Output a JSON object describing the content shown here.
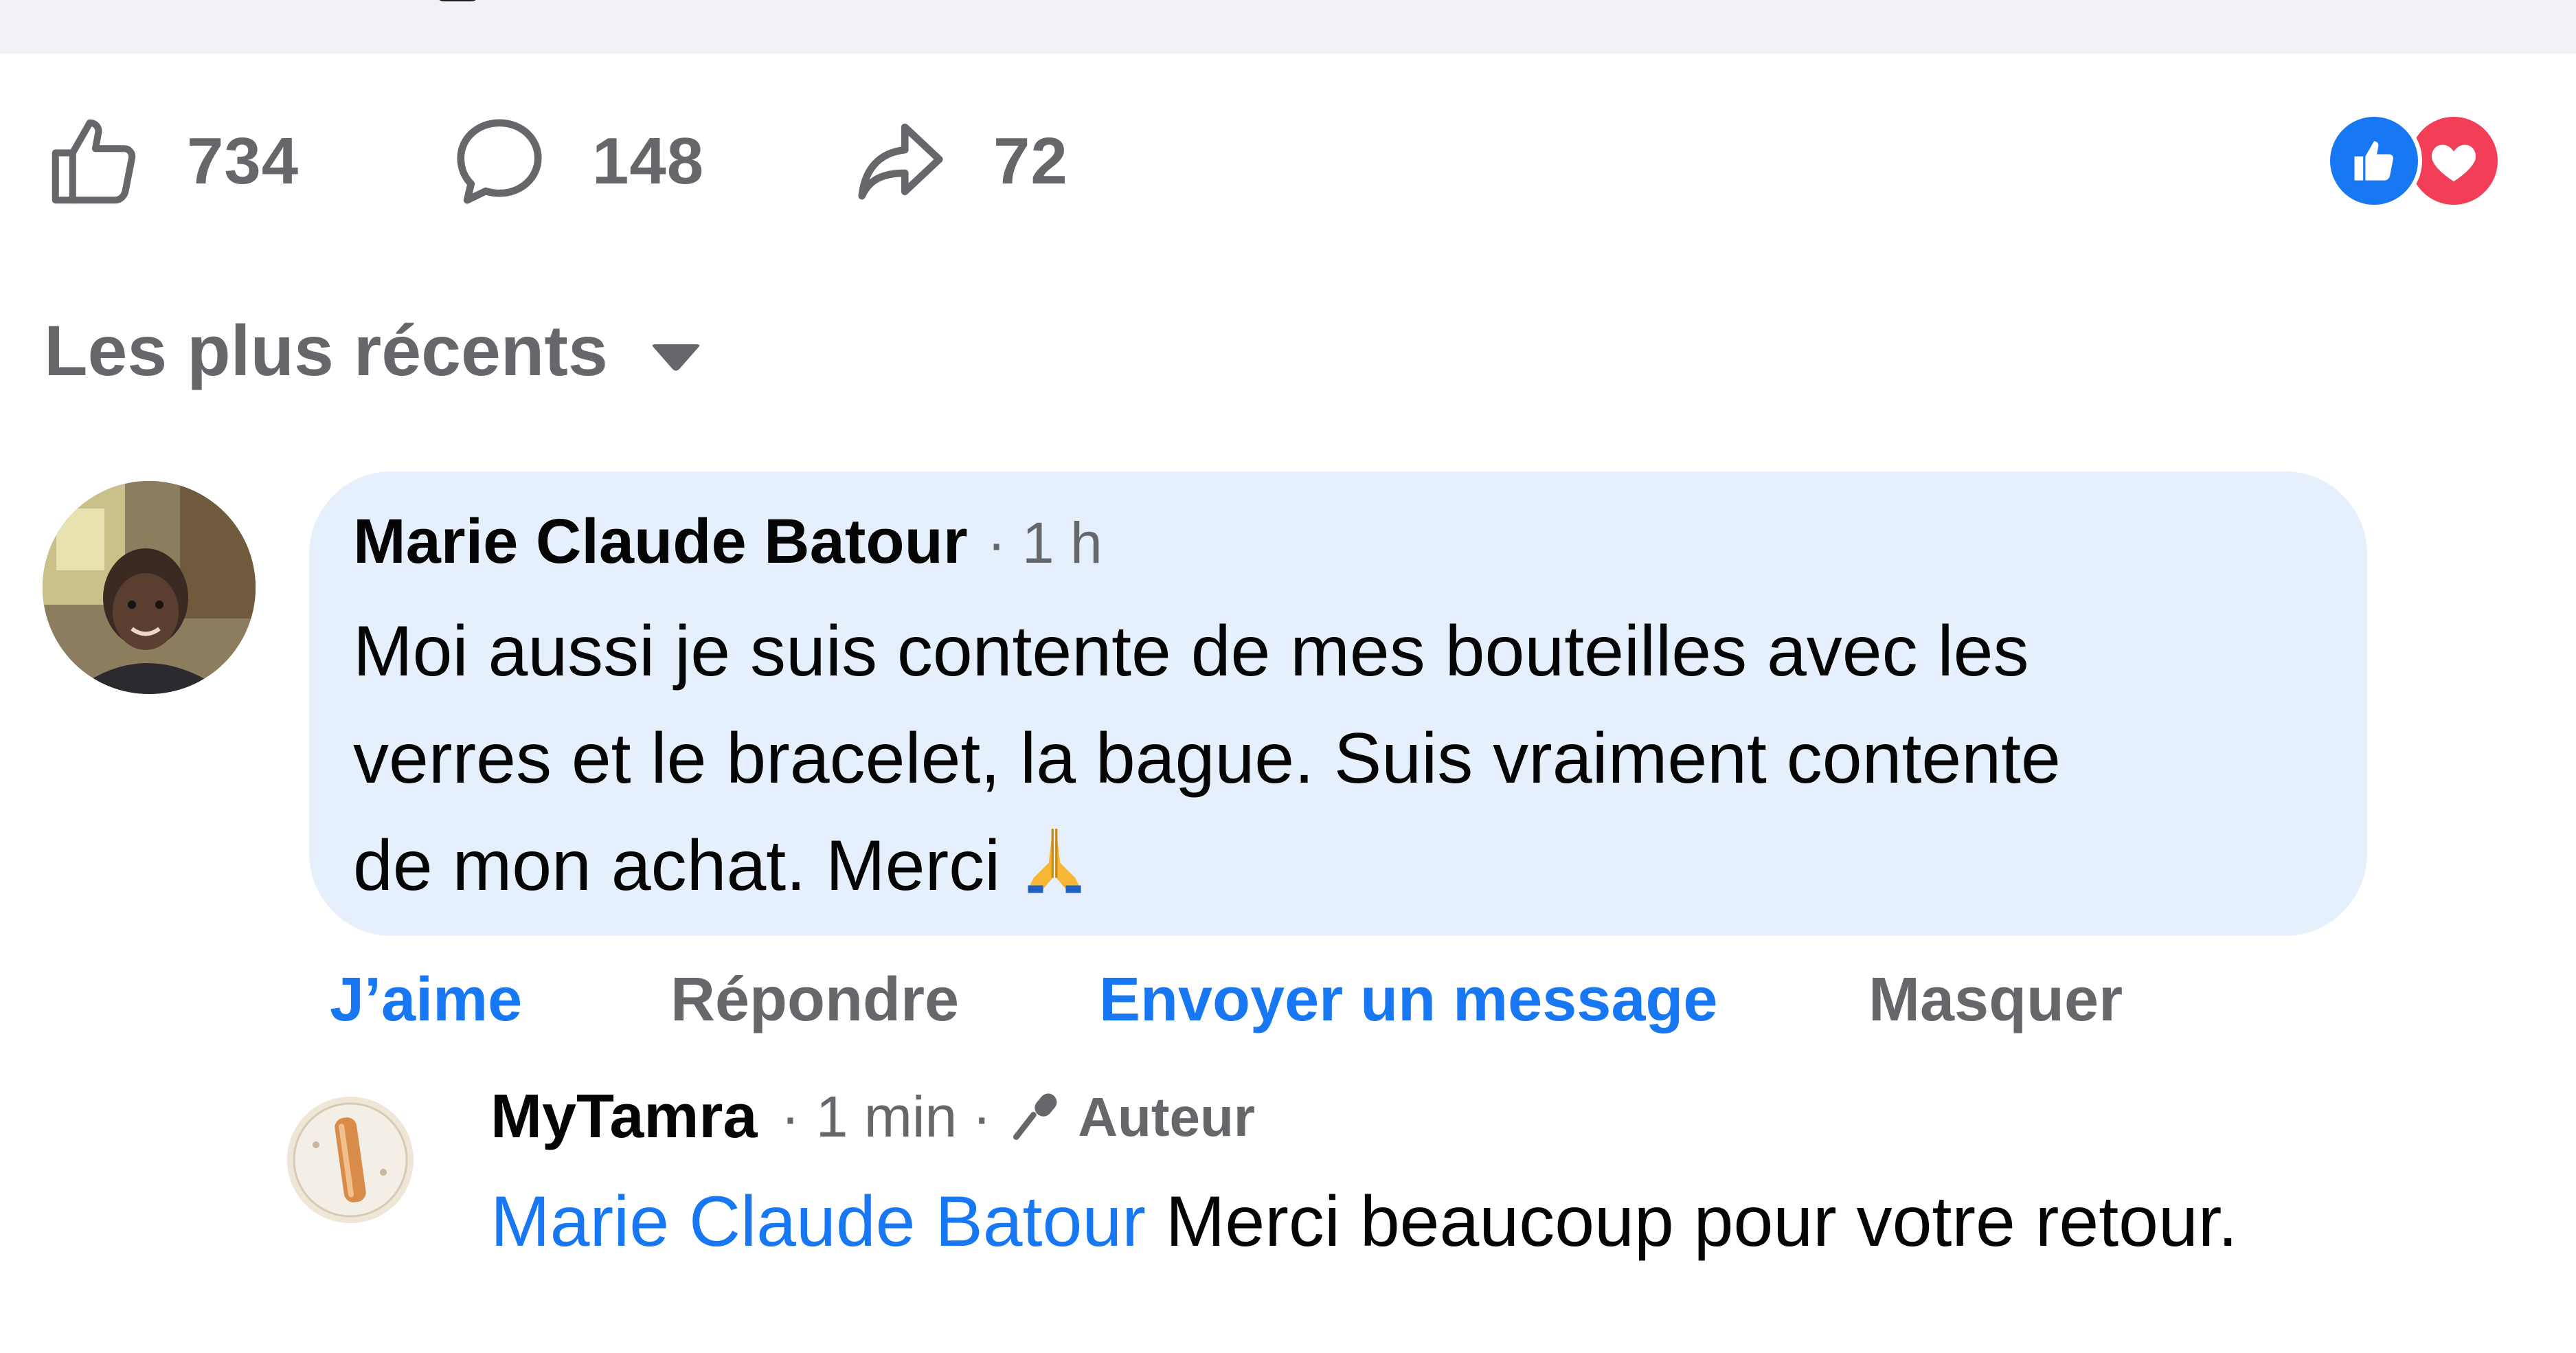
{
  "stats": {
    "likes": "734",
    "comments": "148",
    "shares": "72",
    "icons": [
      "thumbs-up-icon",
      "comment-bubble-icon",
      "share-arrow-icon"
    ]
  },
  "reactions": [
    "like-reaction-icon",
    "love-reaction-icon"
  ],
  "sort": {
    "label": "Les plus récents"
  },
  "comment": {
    "author": "Marie Claude Batour",
    "time": "· 1 h",
    "text_line1": "Moi aussi je suis contente de mes bouteilles avec les",
    "text_line2": "verres et le bracelet, la bague. Suis vraiment contente",
    "text_line3": "de mon achat. Merci",
    "emoji": "🙏",
    "actions": {
      "like": "J’aime",
      "reply": "Répondre",
      "message": "Envoyer un message",
      "hide": "Masquer"
    }
  },
  "reply": {
    "author": "MyTamra",
    "time": "· 1 min",
    "separator": "·",
    "badge": "Auteur",
    "mention": "Marie Claude Batour",
    "text": " Merci beaucoup pour votre retour."
  },
  "colors": {
    "accent": "#1877f2",
    "secondary_text": "#65676b",
    "bubble": "#e6f0fd",
    "love": "#f33e58"
  }
}
